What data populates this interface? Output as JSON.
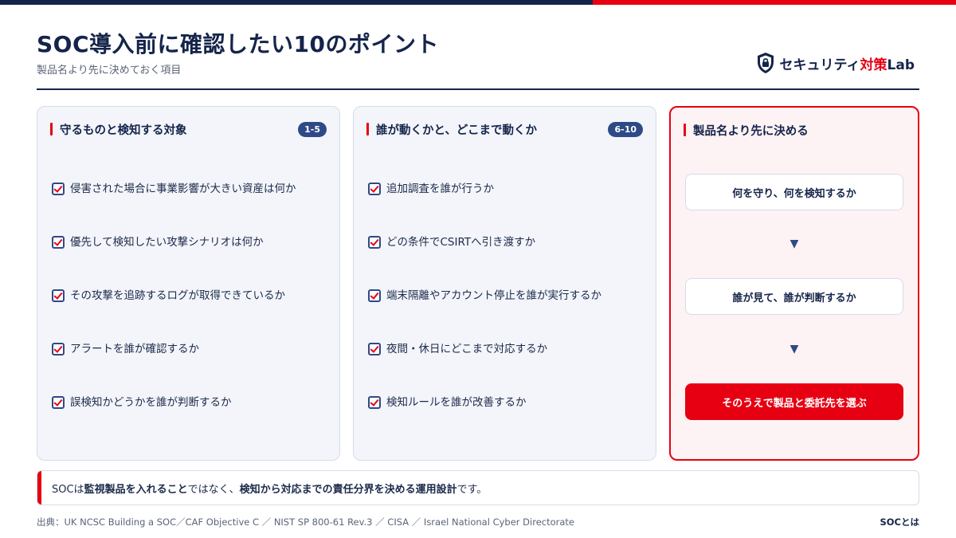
{
  "colors": {
    "navy": "#15244a",
    "accent": "#e60012",
    "badge": "#2e4a86"
  },
  "header": {
    "title": "SOC導入前に確認したい10のポイント",
    "subtitle": "製品名より先に決めておく項目"
  },
  "logo": {
    "icon": "shield-lock-icon",
    "text_main": "セキュリティ",
    "text_accent": "対策",
    "text_end": "Lab"
  },
  "panels": [
    {
      "title": "守るものと検知する対象",
      "badge": "1-5",
      "items": [
        "侵害された場合に事業影響が大きい資産は何か",
        "優先して検知したい攻撃シナリオは何か",
        "その攻撃を追跡するログが取得できているか",
        "アラートを誰が確認するか",
        "誤検知かどうかを誰が判断するか"
      ]
    },
    {
      "title": "誰が動くかと、どこまで動くか",
      "badge": "6-10",
      "items": [
        "追加調査を誰が行うか",
        "どの条件でCSIRTへ引き渡すか",
        "端末隔離やアカウント停止を誰が実行するか",
        "夜間・休日にどこまで対応するか",
        "検知ルールを誰が改善するか"
      ]
    },
    {
      "title": "製品名より先に決める",
      "flow": [
        "何を守り、何を検知するか",
        "誰が見て、誰が判断するか",
        "そのうえで製品と委託先を選ぶ"
      ],
      "arrow": "▼"
    }
  ],
  "note": {
    "p1": "SOCは",
    "b1": "監視製品を入れること",
    "p2": "ではなく、",
    "b2": "検知から対応までの責任分界を決める運用設計",
    "p3": "です。"
  },
  "footer": {
    "source": "出典：UK NCSC Building a SOC／CAF Objective C ／ NIST SP 800-61 Rev.3 ／ CISA ／ Israel National Cyber Directorate",
    "label": "SOCとは"
  }
}
